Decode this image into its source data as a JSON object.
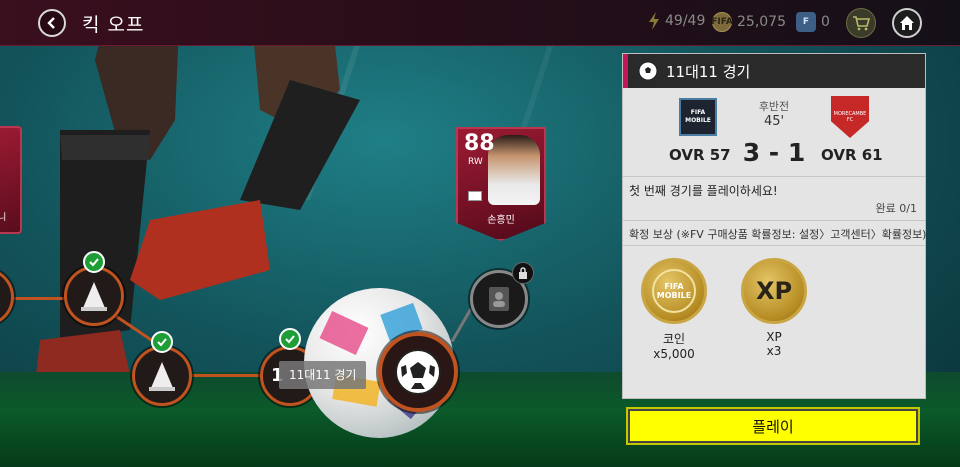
{
  "header": {
    "title": "킥 오프",
    "energy": "49/49",
    "coins": "25,075",
    "fv_points": "0",
    "fv_label": "F"
  },
  "player_card": {
    "rating": "88",
    "position": "RW",
    "name": "손흥민"
  },
  "side_card": {
    "name_fragment": "니"
  },
  "path": {
    "current_node_label": "11대11 경기",
    "current_node_number": "1"
  },
  "panel": {
    "title": "11대11 경기",
    "period": "후반전",
    "minute": "45'",
    "home_ovr": "OVR 57",
    "score": "3 - 1",
    "away_ovr": "OVR 61",
    "home_logo_text": "FIFA MOBILE",
    "away_logo_text": "MORECAMBE FC",
    "mission_text": "첫 번째 경기를 플레이하세요!",
    "mission_progress": "완료 0/1",
    "reward_header": "확정 보상 (※FV 구매상품 확률정보: 설정〉고객센터〉확률정보)",
    "rewards": [
      {
        "label": "코인",
        "qty": "x5,000",
        "icon_text": "FIFA MOBILE"
      },
      {
        "label": "XP",
        "qty": "x3",
        "icon_text": "XP"
      }
    ]
  },
  "play_button": {
    "label": "플레이"
  },
  "colors": {
    "accent": "#c0531f",
    "play_button": "#ffff00",
    "check": "#1f9e37",
    "panel_header_accent": "#c2185b"
  },
  "icons": [
    "back-icon",
    "energy-icon",
    "coin-icon",
    "fv-icon",
    "cart-icon",
    "home-icon",
    "soccer-ball-icon",
    "cone-icon",
    "check-icon",
    "lock-icon",
    "player-silhouette-icon"
  ]
}
